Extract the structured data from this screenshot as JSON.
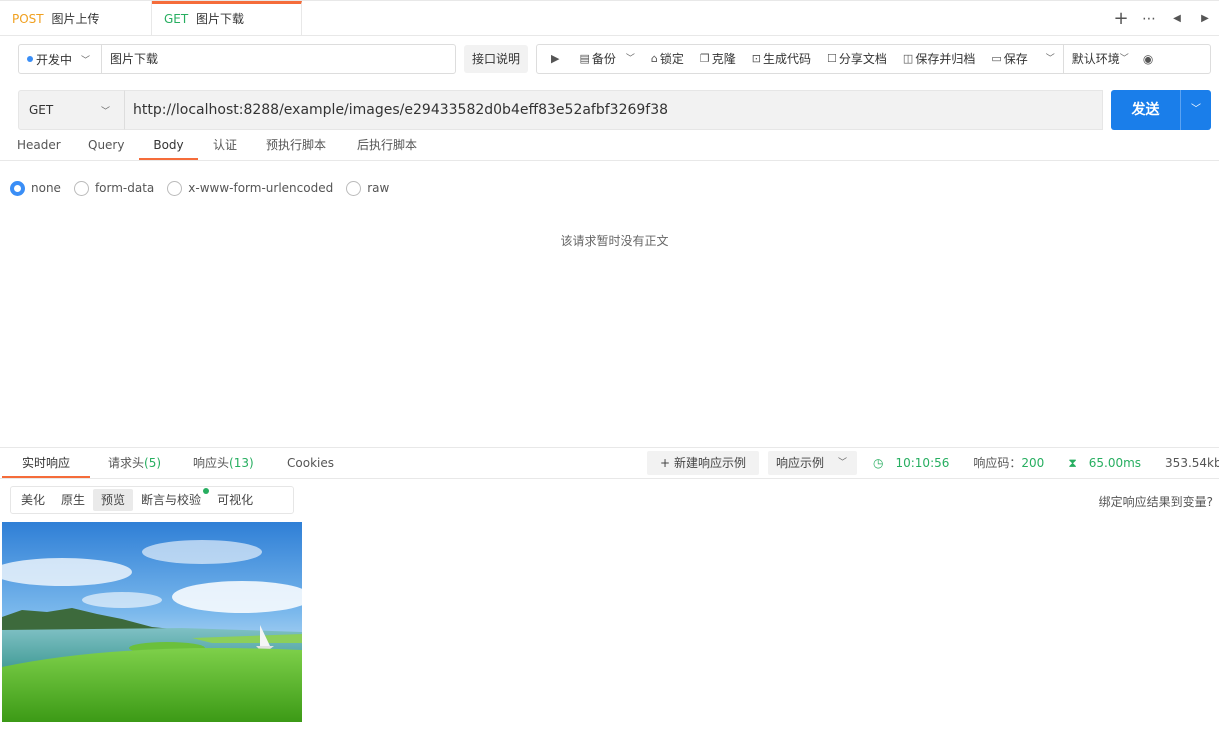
{
  "tabs": [
    {
      "method": "POST",
      "name": "图片上传"
    },
    {
      "method": "GET",
      "name": "图片下载"
    }
  ],
  "tab_icons": [
    "plus-icon",
    "more-icon",
    "arrow-left-icon",
    "arrow-right-icon"
  ],
  "toolbar": {
    "status": "开发中",
    "name": "图片下载",
    "doc_button": "接口说明",
    "actions": {
      "backup": "备份",
      "lock": "锁定",
      "clone": "克隆",
      "gencode": "生成代码",
      "share": "分享文档",
      "save_archive": "保存并归档",
      "save": "保存",
      "env": "默认环境"
    }
  },
  "request": {
    "method": "GET",
    "url": "http://localhost:8288/example/images/e29433582d0b4eff83e52afbf3269f38",
    "send": "发送"
  },
  "req_tabs": {
    "header": "Header",
    "query": "Query",
    "body": "Body",
    "auth": "认证",
    "pre_script": "预执行脚本",
    "post_script": "后执行脚本"
  },
  "body_types": {
    "none": "none",
    "form_data": "form-data",
    "urlencoded": "x-www-form-urlencoded",
    "raw": "raw"
  },
  "empty_body": "该请求暂时没有正文",
  "response": {
    "tabs": {
      "realtime": "实时响应",
      "req_headers": "请求头",
      "req_headers_count": "(5)",
      "resp_headers": "响应头",
      "resp_headers_count": "(13)",
      "cookies": "Cookies"
    },
    "new_example": "新建响应示例",
    "example_select": "响应示例",
    "time": "10:10:56",
    "code_label": "响应码：",
    "code": "200",
    "duration": "65.00ms",
    "size": "353.54kb",
    "view_modes": {
      "pretty": "美化",
      "raw": "原生",
      "preview": "预览",
      "assert": "断言与校验",
      "visual": "可视化"
    },
    "bind_var": "绑定响应结果到变量?"
  },
  "colors": {
    "accent": "#f56c3a",
    "primary": "#1a7eea",
    "get": "#27ae60",
    "post": "#f0a020"
  }
}
